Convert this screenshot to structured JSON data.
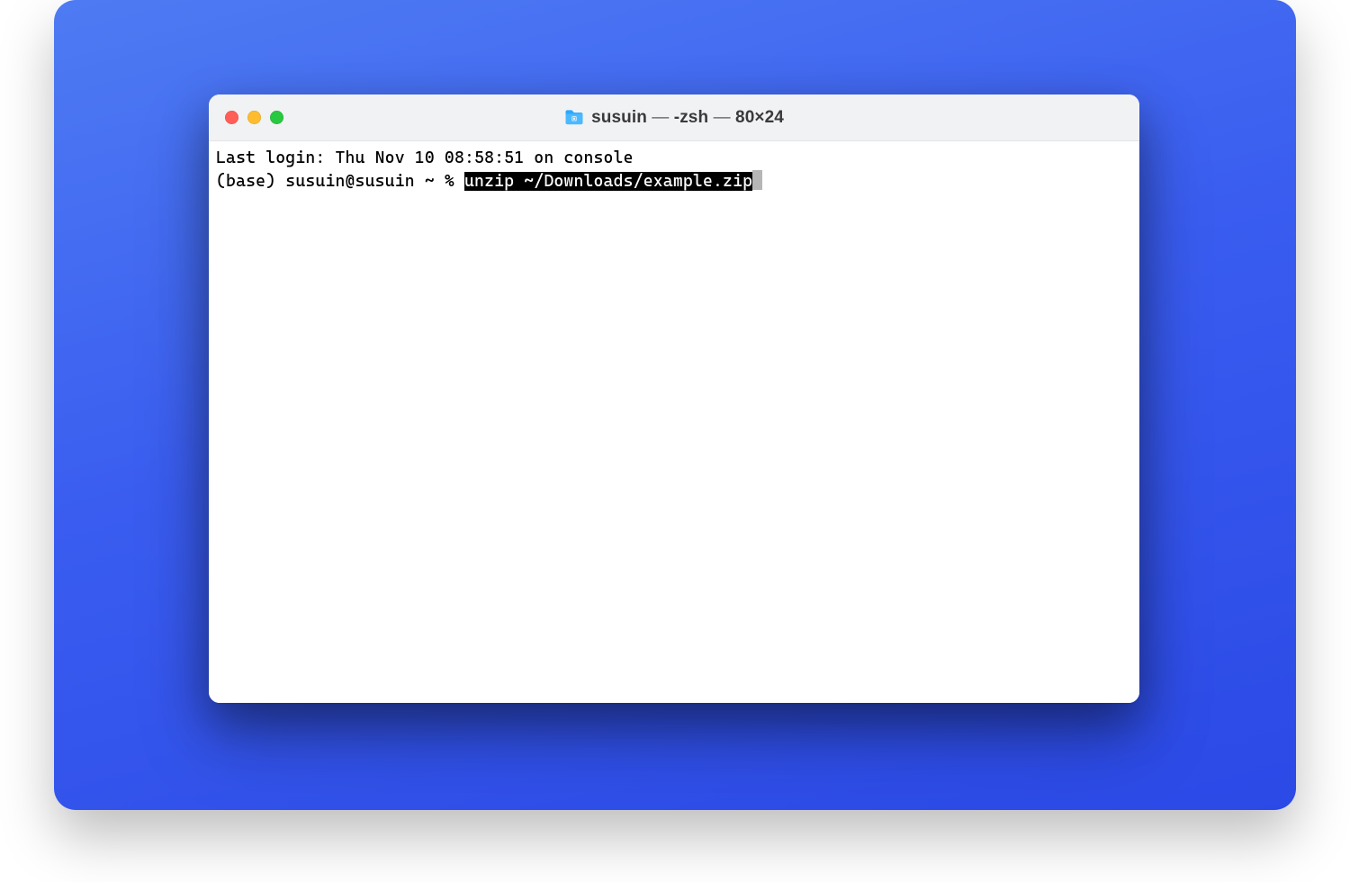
{
  "window": {
    "title_user": "susuin",
    "title_shell": "-zsh",
    "title_size": "80×24",
    "dash": " — "
  },
  "terminal": {
    "line1": "Last login: Thu Nov 10 08:58:51 on console",
    "prompt": "(base) susuin@susuin ~ % ",
    "selected_command": "unzip ~/Downloads/example.zip"
  }
}
